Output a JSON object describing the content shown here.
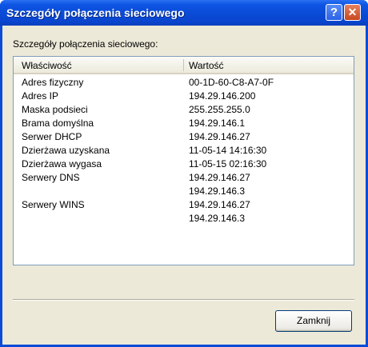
{
  "window": {
    "title": "Szczegóły połączenia sieciowego",
    "help_label": "?",
    "close_label": "✕"
  },
  "dialog": {
    "caption": "Szczegóły połączenia sieciowego:",
    "columns": [
      "Właściwość",
      "Wartość"
    ],
    "rows": [
      {
        "property": "Adres fizyczny",
        "value": "00-1D-60-C8-A7-0F"
      },
      {
        "property": "Adres IP",
        "value": "194.29.146.200"
      },
      {
        "property": "Maska podsieci",
        "value": "255.255.255.0"
      },
      {
        "property": "Brama domyślna",
        "value": "194.29.146.1"
      },
      {
        "property": "Serwer DHCP",
        "value": "194.29.146.27"
      },
      {
        "property": "Dzierżawa uzyskana",
        "value": "11-05-14 14:16:30"
      },
      {
        "property": "Dzierżawa wygasa",
        "value": "11-05-15 02:16:30"
      },
      {
        "property": "Serwery DNS",
        "value": "194.29.146.27"
      },
      {
        "property": "",
        "value": "194.29.146.3"
      },
      {
        "property": "Serwery WINS",
        "value": "194.29.146.27"
      },
      {
        "property": "",
        "value": "194.29.146.3"
      }
    ],
    "close_button": "Zamknij"
  }
}
